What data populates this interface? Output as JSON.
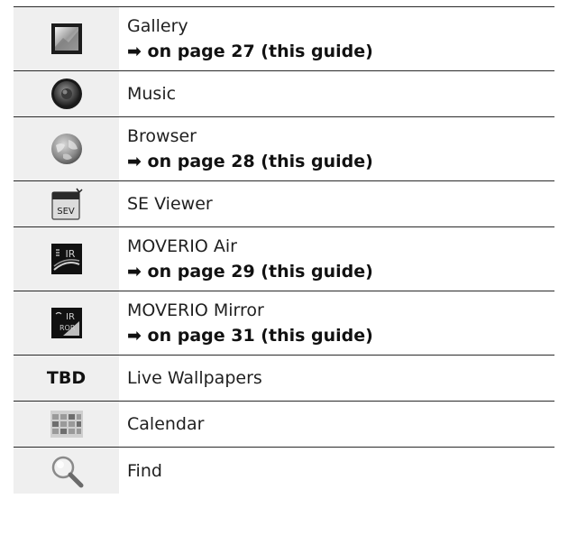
{
  "apps": [
    {
      "name": "Gallery",
      "ref": "➡ on page 27 (this guide)",
      "icon": "gallery-icon"
    },
    {
      "name": "Music",
      "icon": "music-speaker-icon"
    },
    {
      "name": "Browser",
      "ref": "➡ on page 28 (this guide)",
      "icon": "globe-icon"
    },
    {
      "name": "SE Viewer",
      "icon": "sev-folder-icon",
      "icon_text": "SEV"
    },
    {
      "name": "MOVERIO Air",
      "ref": "➡ on page 29 (this guide)",
      "icon": "moverio-air-icon",
      "icon_text": "IR"
    },
    {
      "name": "MOVERIO Mirror",
      "ref": "➡ on page 31 (this guide)",
      "icon": "moverio-mirror-icon",
      "icon_text": "IR"
    },
    {
      "name": "Live Wallpapers",
      "icon_label": "TBD"
    },
    {
      "name": "Calendar",
      "icon": "calendar-icon"
    },
    {
      "name": "Find",
      "icon": "magnifier-icon"
    }
  ]
}
